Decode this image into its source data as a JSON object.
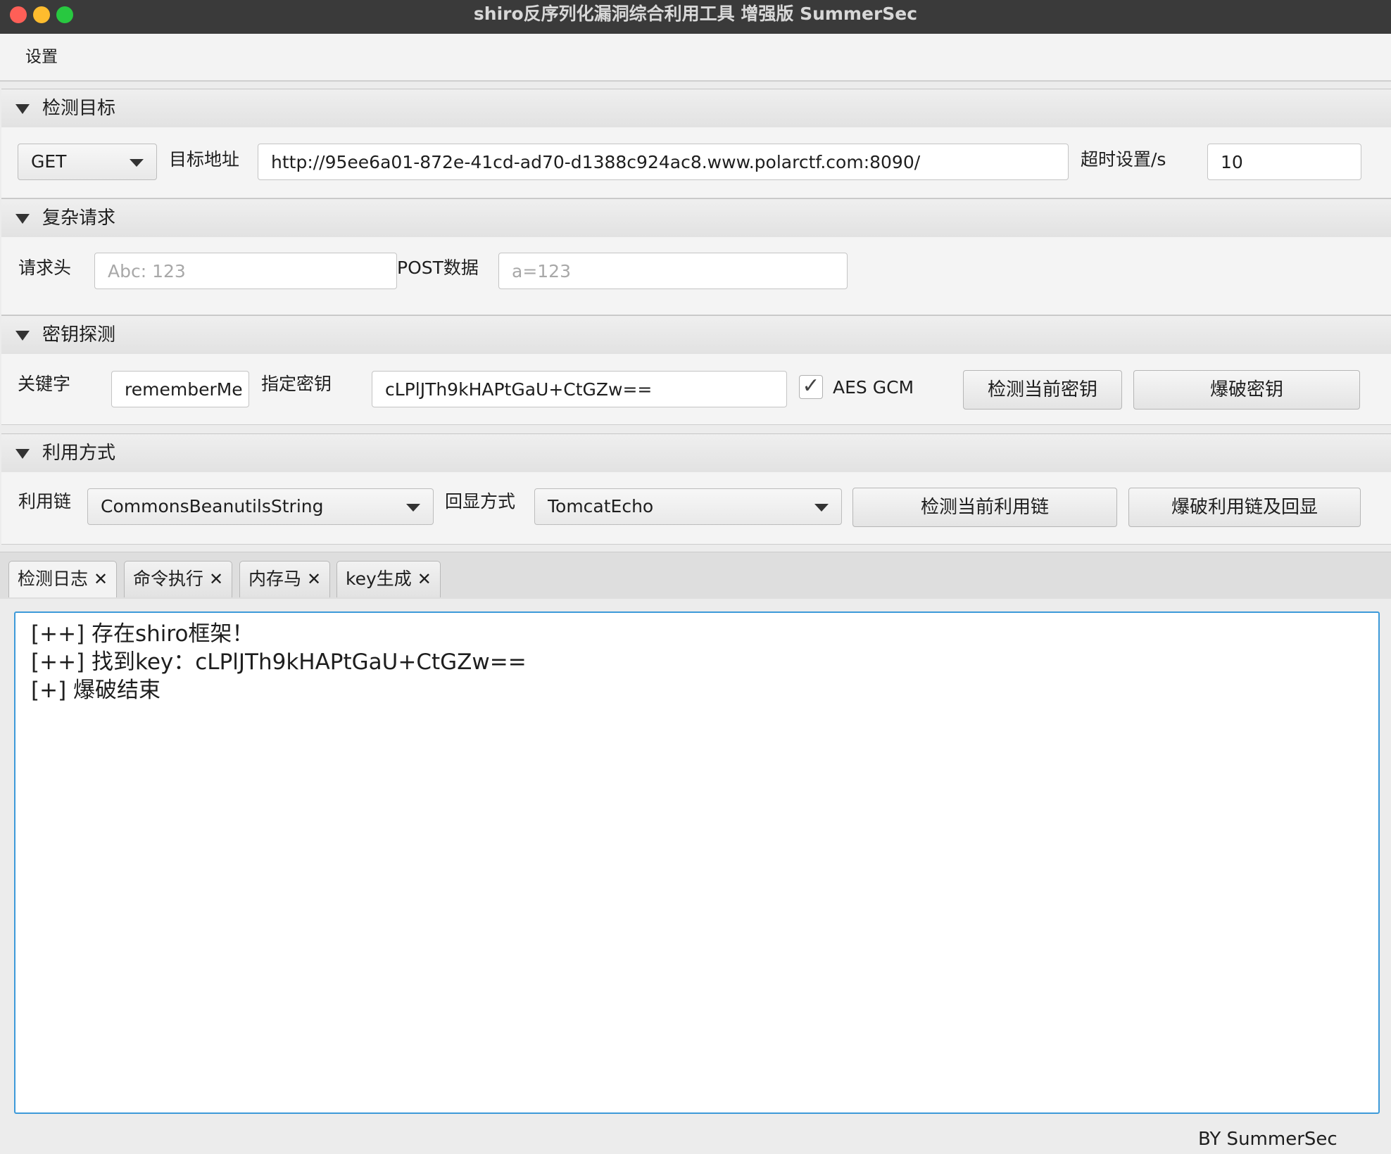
{
  "window": {
    "title": "shiro反序列化漏洞综合利用工具 增强版 SummerSec"
  },
  "menu": {
    "items": [
      "设置"
    ]
  },
  "sections": {
    "target": {
      "title": "检测目标",
      "method": "GET",
      "url_label": "目标地址",
      "url_value": "http://95ee6a01-872e-41cd-ad70-d1388c924ac8.www.polarctf.com:8090/",
      "timeout_label": "超时设置/s",
      "timeout_value": "10"
    },
    "complex": {
      "title": "复杂请求",
      "header_label": "请求头",
      "header_placeholder": "Abc: 123",
      "post_label": "POST数据",
      "post_placeholder": "a=123"
    },
    "key": {
      "title": "密钥探测",
      "keyword_label": "关键字",
      "keyword_value": "rememberMe",
      "key_label": "指定密钥",
      "key_value": "cLPlJTh9kHAPtGaU+CtGZw==",
      "aes_gcm_label": "AES GCM",
      "aes_gcm_checked": true,
      "check_button": "检测当前密钥",
      "brute_button": "爆破密钥"
    },
    "exploit": {
      "title": "利用方式",
      "chain_label": "利用链",
      "chain_value": "CommonsBeanutilsString",
      "echo_label": "回显方式",
      "echo_value": "TomcatEcho",
      "check_button": "检测当前利用链",
      "brute_button": "爆破利用链及回显"
    }
  },
  "tabs": [
    {
      "label": "检测日志",
      "active": true
    },
    {
      "label": "命令执行",
      "active": false
    },
    {
      "label": "内存马",
      "active": false
    },
    {
      "label": "key生成",
      "active": false
    }
  ],
  "log": {
    "lines": [
      "[++] 存在shiro框架！",
      "[++] 找到key：cLPlJTh9kHAPtGaU+CtGZw==",
      "[+] 爆破结束"
    ]
  },
  "footer": {
    "text": "BY  SummerSec"
  },
  "colors": {
    "titlebar": "#3a3a3a",
    "focus_border": "#3d9ad9",
    "close": "#fe5f57",
    "minimize": "#febc2e",
    "zoom": "#28c840"
  }
}
